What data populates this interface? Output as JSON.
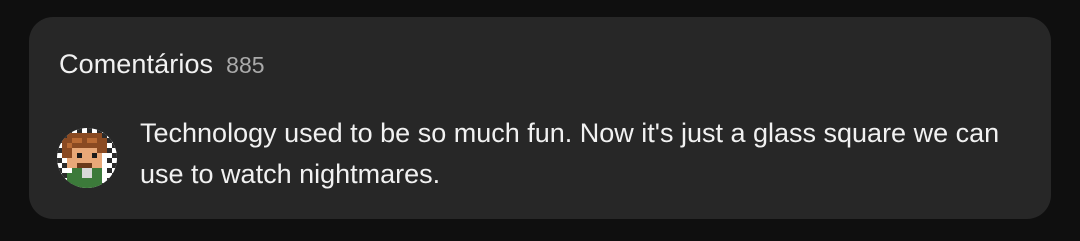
{
  "comments_panel": {
    "title": "Comentários",
    "count": "885"
  },
  "top_comment": {
    "avatar_icon": "pixel-art-character-avatar",
    "text": "Technology used to be so much fun. Now it's just a glass square we can use to watch nightmares."
  },
  "colors": {
    "page_background": "#0f0f0f",
    "card_background": "#272727",
    "primary_text": "#f1f1f1",
    "secondary_text": "#aaaaaa"
  }
}
